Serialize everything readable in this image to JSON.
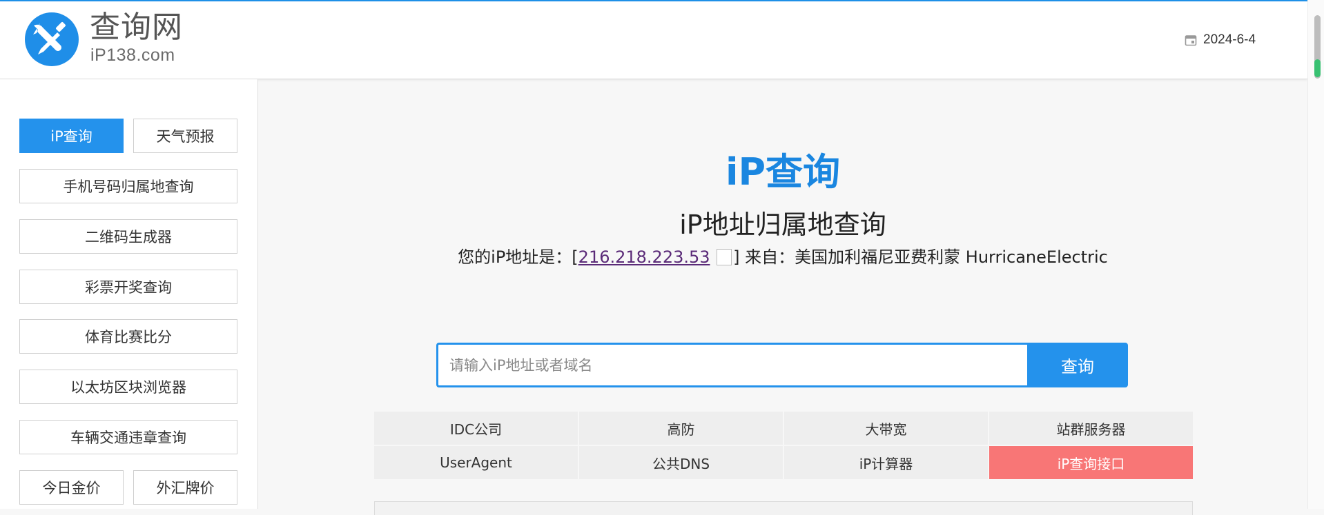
{
  "header": {
    "brand_name": "查询网",
    "brand_domain": "iP138.com",
    "date": "2024-6-4"
  },
  "sidebar": {
    "items": [
      {
        "label": "iP查询",
        "active": true
      },
      {
        "label": "天气预报",
        "active": false
      },
      {
        "label": "手机号码归属地查询",
        "active": false
      },
      {
        "label": "二维码生成器",
        "active": false
      },
      {
        "label": "彩票开奖查询",
        "active": false
      },
      {
        "label": "体育比赛比分",
        "active": false
      },
      {
        "label": "以太坊区块浏览器",
        "active": false
      },
      {
        "label": "车辆交通违章查询",
        "active": false
      },
      {
        "label": "今日金价",
        "active": false
      },
      {
        "label": "外汇牌价",
        "active": false
      }
    ]
  },
  "main": {
    "title": "iP查询",
    "subtitle": "iP地址归属地查询",
    "myip_prefix": "您的iP地址是：[",
    "myip_address": "216.218.223.53",
    "myip_suffix": "] 来自：美国加利福尼亚费利蒙 HurricaneElectric",
    "search_placeholder": "请输入iP地址或者域名",
    "search_button": "查询",
    "links": [
      "IDC公司",
      "高防",
      "大带宽",
      "站群服务器",
      "UserAgent",
      "公共DNS",
      "iP计算器",
      "iP查询接口"
    ]
  },
  "colors": {
    "accent": "#2492ec",
    "highlight": "#f87676"
  }
}
